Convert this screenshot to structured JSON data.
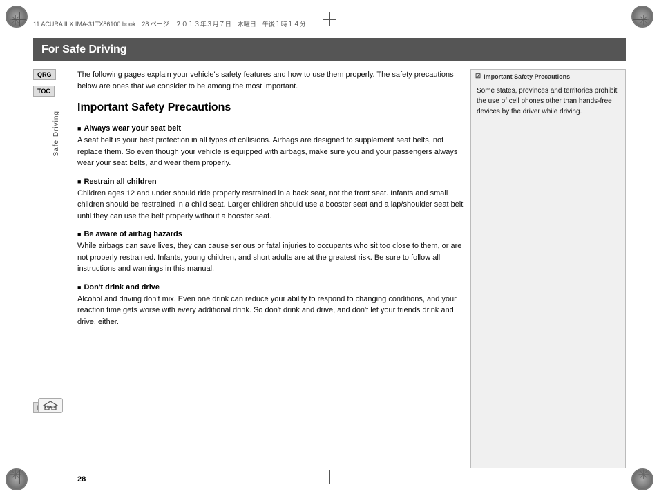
{
  "page": {
    "number": "28",
    "top_info": "11 ACURA ILX IMA-31TX86100.book　28 ページ　２０１３年３月７日　木曜日　午後１時１４分"
  },
  "header": {
    "title": "For Safe Driving"
  },
  "sidebar": {
    "qrg_label": "QRG",
    "toc_label": "TOC",
    "toc_vertical": "Safe Driving",
    "index_label": "Index",
    "home_label": "Home"
  },
  "intro": {
    "text": "The following pages explain your vehicle's safety features and how to use them properly. The safety precautions below are ones that we consider to be among the most important."
  },
  "section": {
    "title": "Important Safety Precautions",
    "subsections": [
      {
        "title": "Always wear your seat belt",
        "body": "A seat belt is your best protection in all types of collisions. Airbags are designed to supplement seat belts, not replace them. So even though your vehicle is equipped with airbags, make sure you and your passengers always wear your seat belts, and wear them properly."
      },
      {
        "title": "Restrain all children",
        "body": "Children ages 12 and under should ride properly restrained in a back seat, not the front seat. Infants and small children should be restrained in a child seat. Larger children should use a booster seat and a lap/shoulder seat belt until they can use the belt properly without a booster seat."
      },
      {
        "title": "Be aware of airbag hazards",
        "body": "While airbags can save lives, they can cause serious or fatal injuries to occupants who sit too close to them, or are not properly restrained. Infants, young children, and short adults are at the greatest risk. Be sure to follow all instructions and warnings in this manual."
      },
      {
        "title": "Don't drink and drive",
        "body": "Alcohol and driving don't mix. Even one drink can reduce your ability to respond to changing conditions, and your reaction time gets worse with every additional drink. So don't drink and drive, and don't let your friends drink and drive, either."
      }
    ]
  },
  "right_panel": {
    "header": "Important Safety Precautions",
    "body": "Some states, provinces and territories prohibit the use of cell phones other than hands-free devices by the driver while driving."
  }
}
